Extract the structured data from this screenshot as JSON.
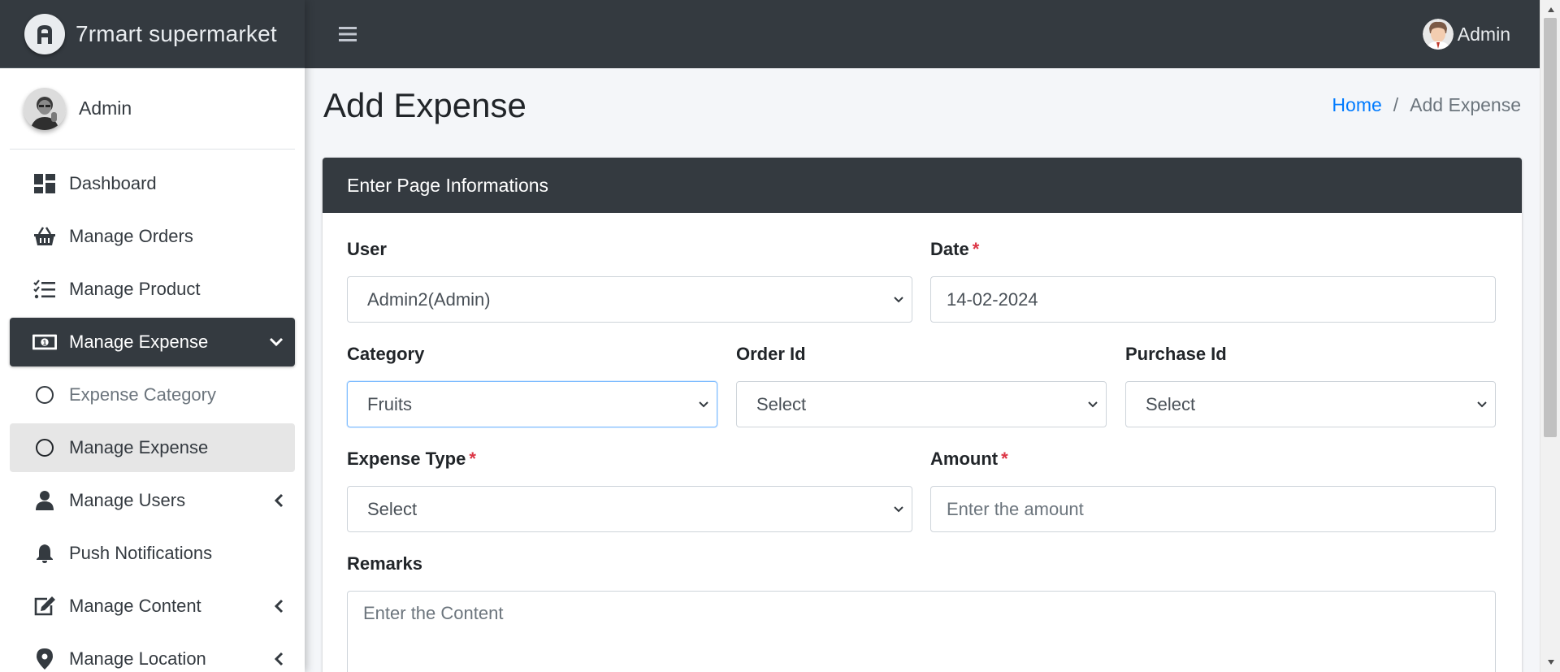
{
  "brand": {
    "name": "7rmart supermarket"
  },
  "sidebar": {
    "user_name": "Admin",
    "items": [
      {
        "label": "Dashboard",
        "icon": "dashboard-icon"
      },
      {
        "label": "Manage Orders",
        "icon": "basket-icon"
      },
      {
        "label": "Manage Product",
        "icon": "tasks-icon"
      },
      {
        "label": "Manage Expense",
        "icon": "money-bill-icon",
        "state": "active",
        "arrow": "chevron-down-icon"
      },
      {
        "label": "Expense Category",
        "icon": "circle-icon",
        "state": "submenu"
      },
      {
        "label": "Manage Expense",
        "icon": "circle-icon",
        "state": "submenu-active"
      },
      {
        "label": "Manage Users",
        "icon": "user-icon",
        "arrow": "chevron-left-icon"
      },
      {
        "label": "Push Notifications",
        "icon": "bell-icon"
      },
      {
        "label": "Manage Content",
        "icon": "edit-icon",
        "arrow": "chevron-left-icon"
      },
      {
        "label": "Manage Location",
        "icon": "map-marker-icon",
        "arrow": "chevron-left-icon"
      }
    ]
  },
  "topbar": {
    "user_name": "Admin",
    "menu_icon": "hamburger-icon"
  },
  "page": {
    "title": "Add Expense",
    "breadcrumb": {
      "home": "Home",
      "separator": "/",
      "current": "Add Expense"
    }
  },
  "card": {
    "title": "Enter Page Informations"
  },
  "form": {
    "user": {
      "label": "User",
      "value": "Admin2(Admin)"
    },
    "date": {
      "label": "Date",
      "required": "*",
      "value": "14-02-2024"
    },
    "category": {
      "label": "Category",
      "value": "Fruits"
    },
    "order_id": {
      "label": "Order Id",
      "value": "Select"
    },
    "purchase_id": {
      "label": "Purchase Id",
      "value": "Select"
    },
    "expense_type": {
      "label": "Expense Type",
      "required": "*",
      "value": "Select"
    },
    "amount": {
      "label": "Amount",
      "required": "*",
      "placeholder": "Enter the amount"
    },
    "remarks": {
      "label": "Remarks",
      "placeholder": "Enter the Content"
    }
  },
  "colors": {
    "navbar": "#343a40",
    "link": "#007bff",
    "required": "#dc3545",
    "background": "#f4f6f9"
  }
}
